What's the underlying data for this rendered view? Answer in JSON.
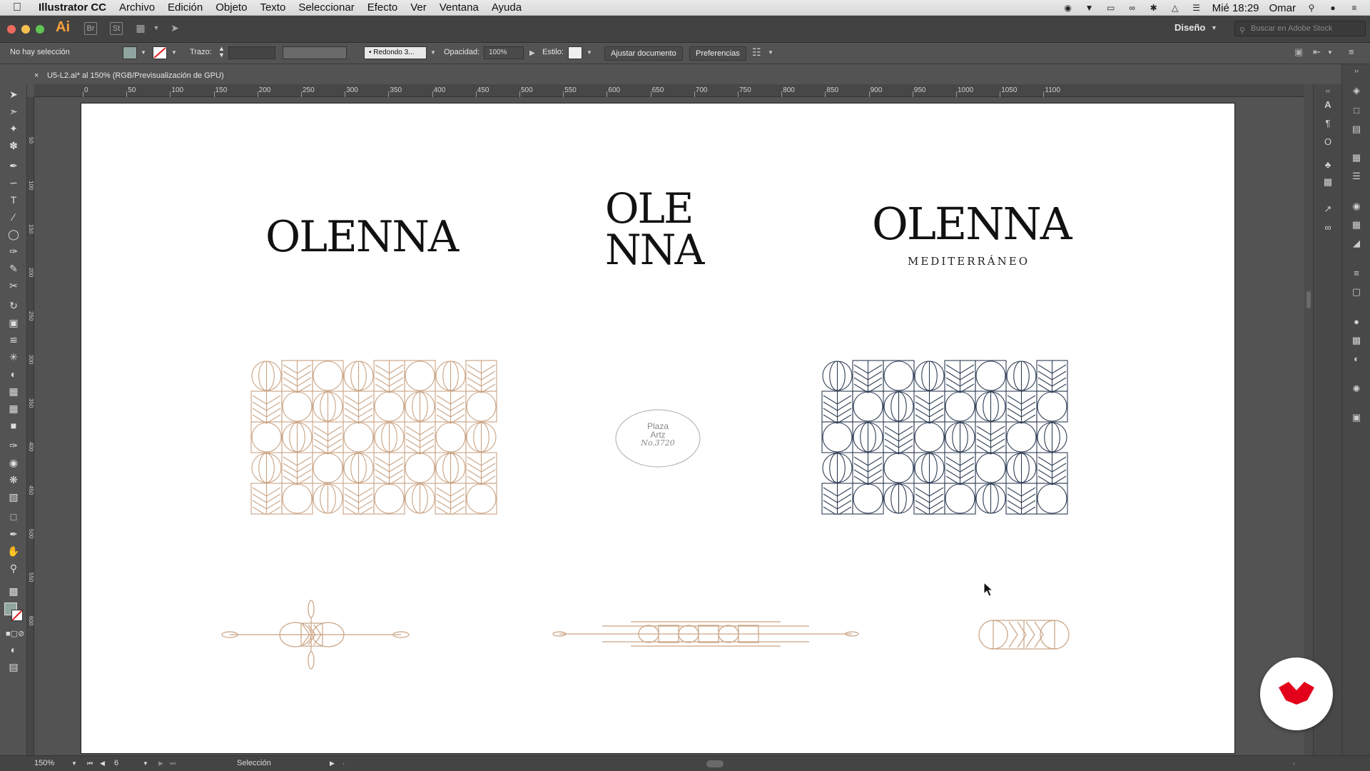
{
  "menubar": {
    "app_name": "Illustrator CC",
    "menus": [
      "Archivo",
      "Edición",
      "Objeto",
      "Texto",
      "Seleccionar",
      "Efecto",
      "Ver",
      "Ventana",
      "Ayuda"
    ],
    "clock": "Mié 18:29",
    "user": "Omar"
  },
  "appbar": {
    "logo": "Ai",
    "bridge_label": "Br",
    "stock_label": "St",
    "workspace": "Diseño",
    "stock_search_placeholder": "Buscar en Adobe Stock"
  },
  "controlbar": {
    "selection_status": "No hay selección",
    "stroke_label": "Trazo:",
    "brush_value": "Redondo 3...",
    "opacity_label": "Opacidad:",
    "opacity_value": "100%",
    "style_label": "Estilo:",
    "fit_button": "Ajustar documento",
    "prefs_button": "Preferencias",
    "fill_color": "#8fa6a0"
  },
  "document": {
    "tab_title": "U5-L2.ai* al 150% (RGB/Previsualización de GPU)"
  },
  "ruler": {
    "top_ticks": [
      "0",
      "50",
      "100",
      "150",
      "200",
      "250",
      "300",
      "350",
      "400",
      "450",
      "500",
      "550",
      "600",
      "650",
      "700",
      "750",
      "800",
      "850",
      "900",
      "950",
      "1000",
      "1050",
      "1100"
    ],
    "left_ticks": [
      "50",
      "100",
      "150",
      "200",
      "250",
      "300",
      "350",
      "400",
      "450",
      "500",
      "550",
      "600"
    ]
  },
  "artwork": {
    "logo_wordmark": "OLENNA",
    "logo_stacked_top": "OLE",
    "logo_stacked_bottom": "NNA",
    "logo_tagline": "MEDITERRÁNEO",
    "stamp_line1": "Plaza",
    "stamp_line2": "Artz",
    "stamp_line3": "No.3720",
    "pattern_color_gold": "#c9a383",
    "pattern_color_navy": "#2f3e55"
  },
  "statusbar": {
    "zoom": "150%",
    "artboard_number": "6",
    "tool_name": "Selección"
  },
  "badge": {
    "brand_color": "#e3001b"
  }
}
